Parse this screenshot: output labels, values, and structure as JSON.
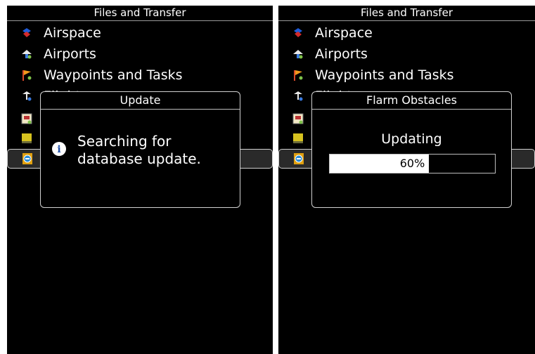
{
  "left": {
    "title": "Files and Transfer",
    "items": [
      {
        "label": "Airspace",
        "icon": "airspace-icon"
      },
      {
        "label": "Airports",
        "icon": "airports-icon"
      },
      {
        "label": "Waypoints and Tasks",
        "icon": "waypoints-icon"
      },
      {
        "label": "Flights",
        "icon": "flights-icon"
      }
    ],
    "dialog": {
      "title": "Update",
      "message": "Searching for database update.",
      "icon": "info-icon"
    }
  },
  "right": {
    "title": "Files and Transfer",
    "items": [
      {
        "label": "Airspace",
        "icon": "airspace-icon"
      },
      {
        "label": "Airports",
        "icon": "airports-icon"
      },
      {
        "label": "Waypoints and Tasks",
        "icon": "waypoints-icon"
      },
      {
        "label": "Flights",
        "icon": "flights-icon"
      }
    ],
    "dialog": {
      "title": "Flarm Obstacles",
      "status": "Updating",
      "progress_percent": 60,
      "progress_label": "60%"
    }
  },
  "colors": {
    "background": "#000000",
    "text": "#ffffff",
    "border": "#cfcfcf",
    "selection": "#2a2a2a"
  }
}
